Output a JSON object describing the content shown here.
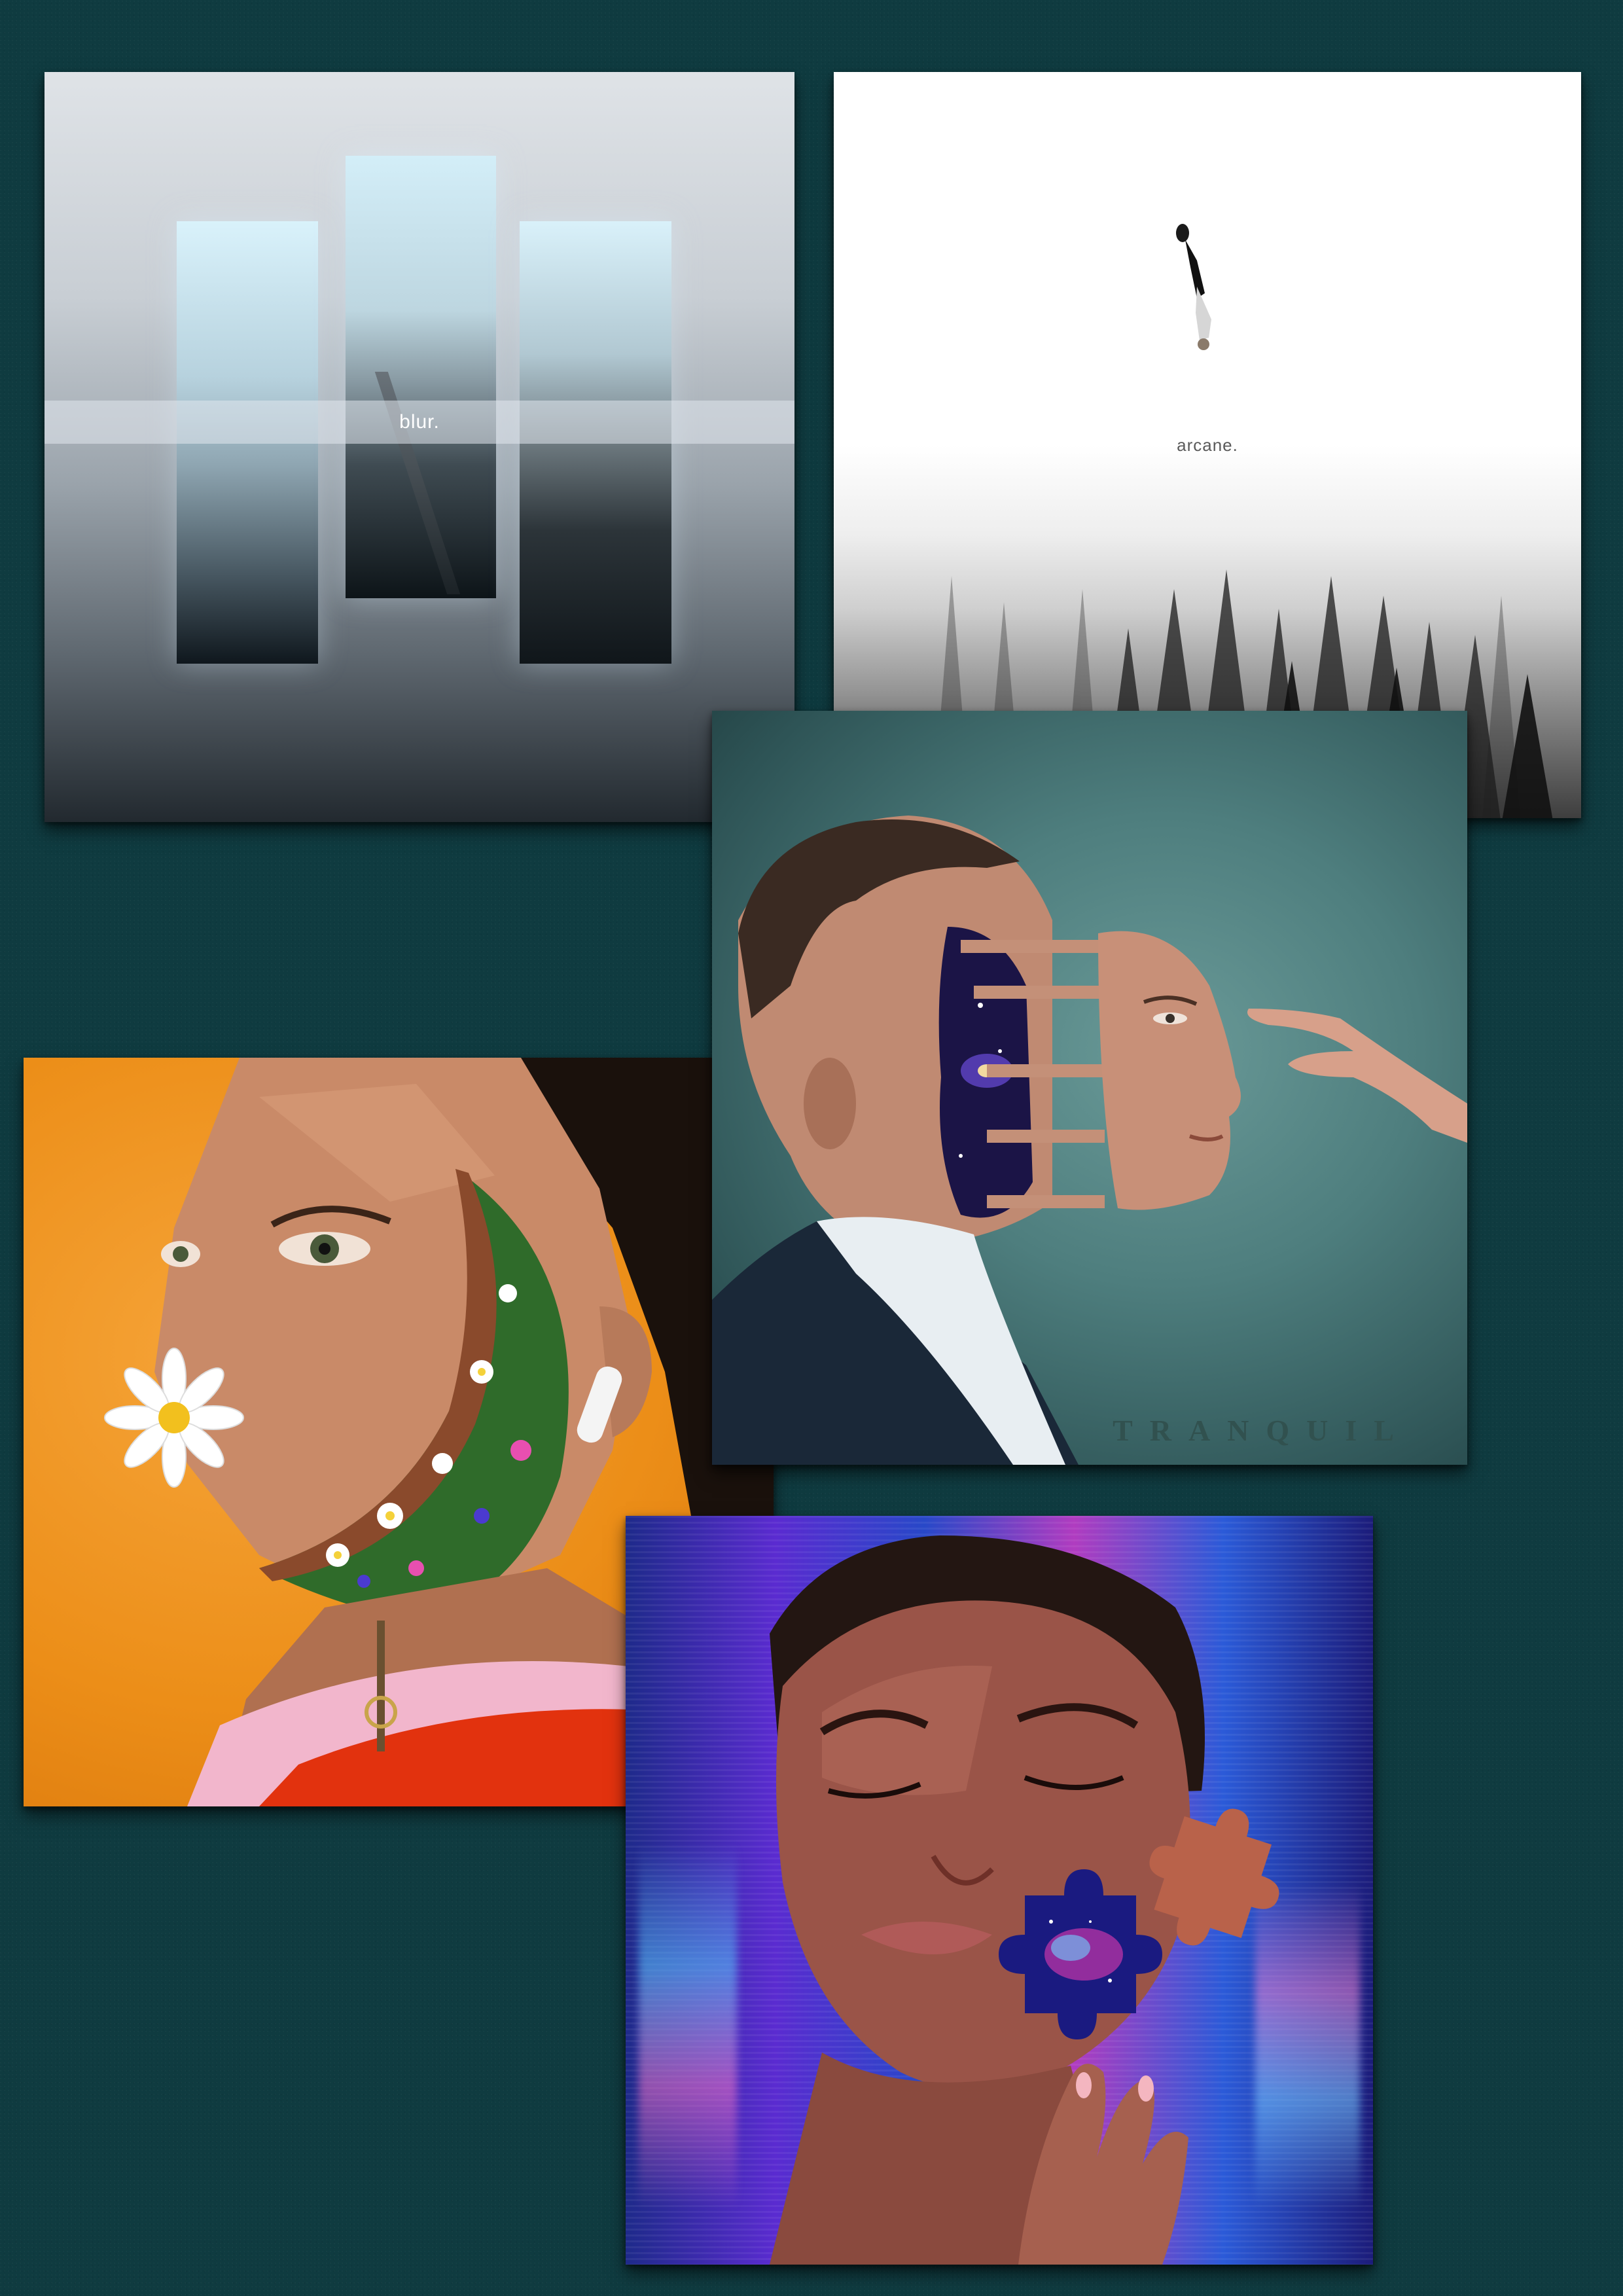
{
  "page": {
    "background_color": "#0f3b40"
  },
  "covers": {
    "blur": {
      "title": "blur."
    },
    "arcane": {
      "title": "arcane."
    },
    "tranquil": {
      "title": "TRANQUIL"
    }
  },
  "colors": {
    "flower_background": "#ec8e18",
    "tranquil_background": "#4e7e7e",
    "puzzle_background": "#2a1f6d"
  }
}
